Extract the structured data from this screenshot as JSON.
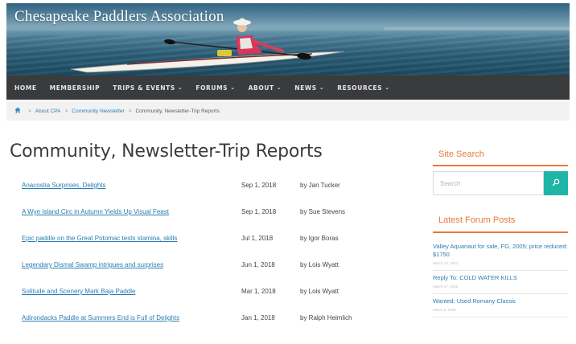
{
  "site": {
    "title": "Chesapeake Paddlers Association"
  },
  "nav": {
    "items": [
      {
        "label": "HOME",
        "has_dropdown": false
      },
      {
        "label": "MEMBERSHIP",
        "has_dropdown": false
      },
      {
        "label": "TRIPS & EVENTS",
        "has_dropdown": true
      },
      {
        "label": "FORUMS",
        "has_dropdown": true
      },
      {
        "label": "ABOUT",
        "has_dropdown": true
      },
      {
        "label": "NEWS",
        "has_dropdown": true
      },
      {
        "label": "RESOURCES",
        "has_dropdown": true
      }
    ],
    "dropdown_glyph": "⌄"
  },
  "breadcrumb": {
    "home_icon": "home-icon",
    "separator": ">",
    "items": [
      "About CPA",
      "Community Newsletter",
      "Community, Newsletter-Trip Reports"
    ]
  },
  "page": {
    "title": "Community, Newsletter-Trip Reports"
  },
  "reports": [
    {
      "title": "Anacostia Surprises, Delights",
      "date": "Sep 1, 2018",
      "author": "by Jan Tucker"
    },
    {
      "title": "A Wye Island Circ in Autumn Yields Up Visual Feast",
      "date": "Sep 1, 2018",
      "author": "by Sue Stevens"
    },
    {
      "title": "Epic paddle on the Great Potomac tests stamina, skills",
      "date": "Jul 1, 2018",
      "author": "by Igor Boras"
    },
    {
      "title": "Legendary Dismal Swamp intrigues and surprises",
      "date": "Jun 1, 2018",
      "author": "by Lois Wyatt"
    },
    {
      "title": "Solitude and Scenery Mark Baja Paddle",
      "date": "Mar 1, 2018",
      "author": "by Lois Wyatt"
    },
    {
      "title": "Adirondacks Paddle at Summers End is Full of Delights",
      "date": "Jan 1, 2018",
      "author": "by Ralph Heimlich"
    }
  ],
  "sidebar": {
    "site_search": {
      "title": "Site Search",
      "placeholder": "Search",
      "button_icon": "search-icon"
    },
    "forum": {
      "title": "Latest Forum Posts",
      "posts": [
        {
          "title": "Valley Aquanaut for sale, FG, 2005; price reduced: $1750",
          "date": "March 18, 2022"
        },
        {
          "title": "Reply To: COLD WATER KILLS",
          "date": "March 17, 2022"
        },
        {
          "title": "Wanted: Used Romany Classic",
          "date": "March 9, 2022"
        }
      ]
    }
  },
  "colors": {
    "nav_bg": "#3a3b3d",
    "link": "#2b7db3",
    "accent_orange": "#e8793a",
    "search_button": "#1fb5a6",
    "breadcrumb_bg": "#f2f2f2"
  }
}
